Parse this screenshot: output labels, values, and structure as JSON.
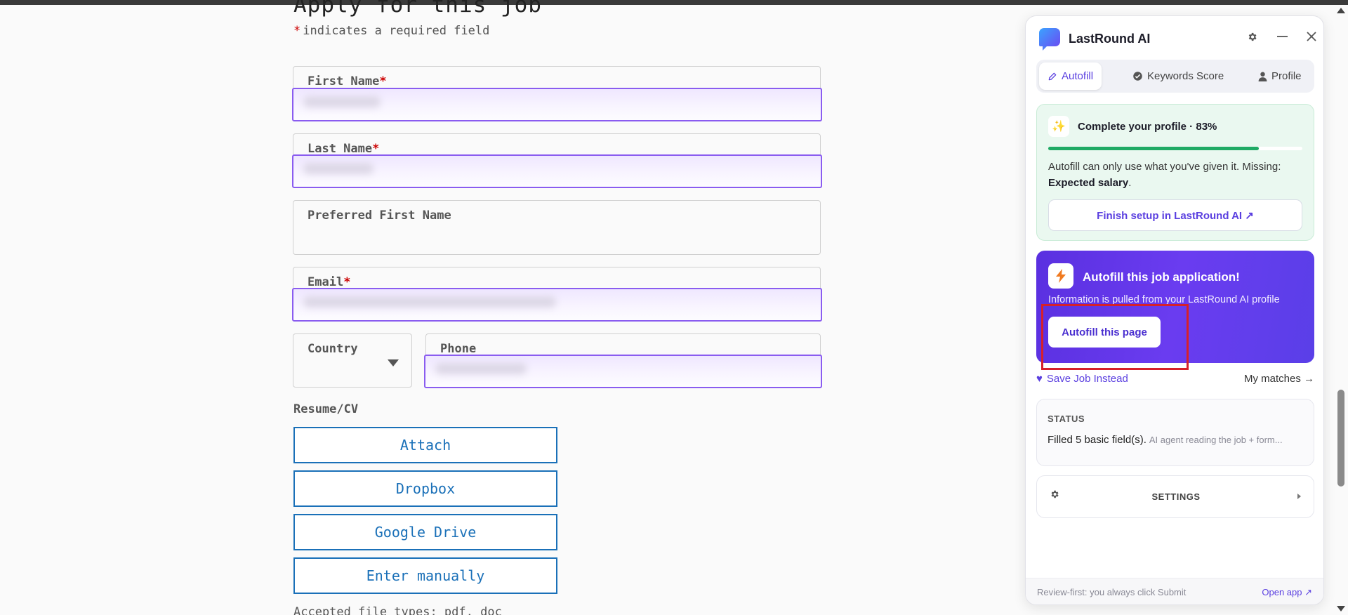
{
  "form": {
    "title": "Apply for this job",
    "required_star": "*",
    "required_note": "indicates a required field",
    "fields": {
      "first_name": "First Name",
      "last_name": "Last Name",
      "preferred_first_name": "Preferred First Name",
      "email": "Email",
      "country": "Country",
      "phone": "Phone"
    },
    "resume_label": "Resume/CV",
    "buttons": {
      "attach": "Attach",
      "dropbox": "Dropbox",
      "google_drive": "Google Drive",
      "enter_manually": "Enter manually"
    },
    "accepted_types": "Accepted file types: pdf, doc"
  },
  "panel": {
    "brand": "LastRound AI",
    "icons": {
      "logo": "chat-bubble-logo",
      "settings": "gear-icon",
      "minimize": "minimize-icon",
      "close": "close-icon"
    },
    "tabs": [
      {
        "label": "Autofill",
        "icon": "pencil-icon",
        "active": true
      },
      {
        "label": "Keywords Score",
        "icon": "check-badge-icon",
        "active": false
      },
      {
        "label": "Profile",
        "icon": "person-icon",
        "active": false
      }
    ],
    "profile_card": {
      "title": "Complete your profile · 83%",
      "progress_percent": 83,
      "text": "Autofill can only use what you've given it. Missing:",
      "missing": "Expected salary",
      "missing_suffix": ".",
      "button": "Finish setup in LastRound AI ↗"
    },
    "autofill_card": {
      "title": "Autofill this job application!",
      "subtitle": "Information is pulled from your LastRound AI profile",
      "button": "Autofill this page"
    },
    "save_job": "Save Job Instead",
    "my_matches": "My matches →",
    "status": {
      "heading": "STATUS",
      "main": "Filled 5 basic field(s).",
      "detail": "AI agent reading the job + form..."
    },
    "settings_label": "SETTINGS",
    "footer": {
      "note": "Review-first: you always click Submit",
      "open_app": "Open app ↗"
    }
  },
  "colors": {
    "accent": "#5a3fe0",
    "highlight_border": "#8a5cf0",
    "required": "#cc0000",
    "link_blue": "#1a70b8",
    "progress": "#1faa65",
    "annotation": "#d6202a"
  }
}
